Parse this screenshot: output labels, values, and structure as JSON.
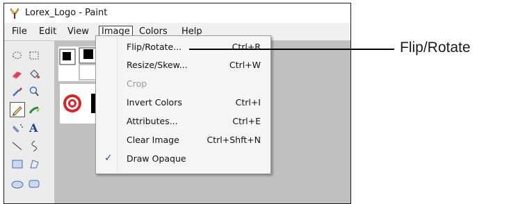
{
  "window": {
    "title": "Lorex_Logo - Paint"
  },
  "menubar": {
    "items": [
      {
        "label": "File"
      },
      {
        "label": "Edit"
      },
      {
        "label": "View"
      },
      {
        "label": "Image"
      },
      {
        "label": "Colors"
      },
      {
        "label": "Help"
      }
    ],
    "active": "Image"
  },
  "image_menu": {
    "items": [
      {
        "label": "Flip/Rotate...",
        "shortcut": "Ctrl+R",
        "enabled": true,
        "highlighted": true
      },
      {
        "label": "Resize/Skew...",
        "shortcut": "Ctrl+W",
        "enabled": true
      },
      {
        "label": "Crop",
        "shortcut": "",
        "enabled": false
      },
      {
        "label": "Invert Colors",
        "shortcut": "Ctrl+I",
        "enabled": true
      },
      {
        "label": "Attributes...",
        "shortcut": "Ctrl+E",
        "enabled": true
      },
      {
        "label": "Clear Image",
        "shortcut": "Ctrl+Shft+N",
        "enabled": true
      },
      {
        "label": "Draw Opaque",
        "shortcut": "",
        "enabled": true,
        "checked": true,
        "check_mark": "✓"
      }
    ]
  },
  "toolbox": {
    "tools": [
      "free-form-select-icon",
      "select-icon",
      "eraser-icon",
      "fill-icon",
      "color-picker-icon",
      "magnifier-icon",
      "pencil-icon",
      "brush-icon",
      "airbrush-icon",
      "text-icon",
      "line-icon",
      "curve-icon",
      "rectangle-icon",
      "polygon-icon",
      "ellipse-icon",
      "rounded-rectangle-icon"
    ],
    "selected": "pencil-icon"
  },
  "callout": {
    "label": "Flip/Rotate"
  },
  "colors": {
    "accent_check": "#2a4ea8",
    "logo_red": "#d6262b"
  }
}
